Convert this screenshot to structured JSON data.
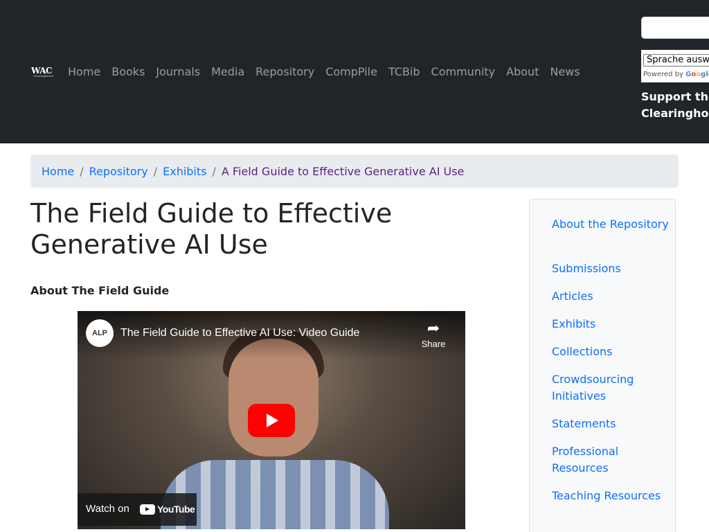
{
  "navbar": {
    "logo": {
      "main": "WAC",
      "sub": "Clearinghouse"
    },
    "links": [
      "Home",
      "Books",
      "Journals",
      "Media",
      "Repository",
      "CompPile",
      "TCBib",
      "Community",
      "About",
      "News"
    ],
    "search": {
      "placeholder": ""
    },
    "translate": {
      "select_label": "Sprache auswählen",
      "powered_by": "Powered by",
      "provider": "Google"
    },
    "support_line1": "Support the",
    "support_line2": "Clearinghouse"
  },
  "breadcrumb": {
    "items": [
      "Home",
      "Repository",
      "Exhibits"
    ],
    "separator": "/",
    "current": "A Field Guide to Effective Generative AI Use"
  },
  "main": {
    "title": "The Field Guide to Effective Generative AI Use",
    "section_heading": "About The Field Guide",
    "video": {
      "channel": "ALP",
      "title": "The Field Guide to Effective AI Use: Video Guide",
      "share_label": "Share",
      "watch_on": "Watch on",
      "platform": "YouTube",
      "colors": {
        "play_button": "#ff0000"
      }
    }
  },
  "sidebar": {
    "items": [
      "About the Repository",
      "Submissions",
      "Articles",
      "Exhibits",
      "Collections",
      "Crowdsourcing Initiatives",
      "Statements",
      "Professional Resources",
      "Teaching Resources"
    ]
  },
  "colors": {
    "navbar_bg": "#212529",
    "link": "#0d6efd",
    "breadcrumb_bg": "#e9ecef",
    "sidebar_bg": "#f8f9fa"
  }
}
